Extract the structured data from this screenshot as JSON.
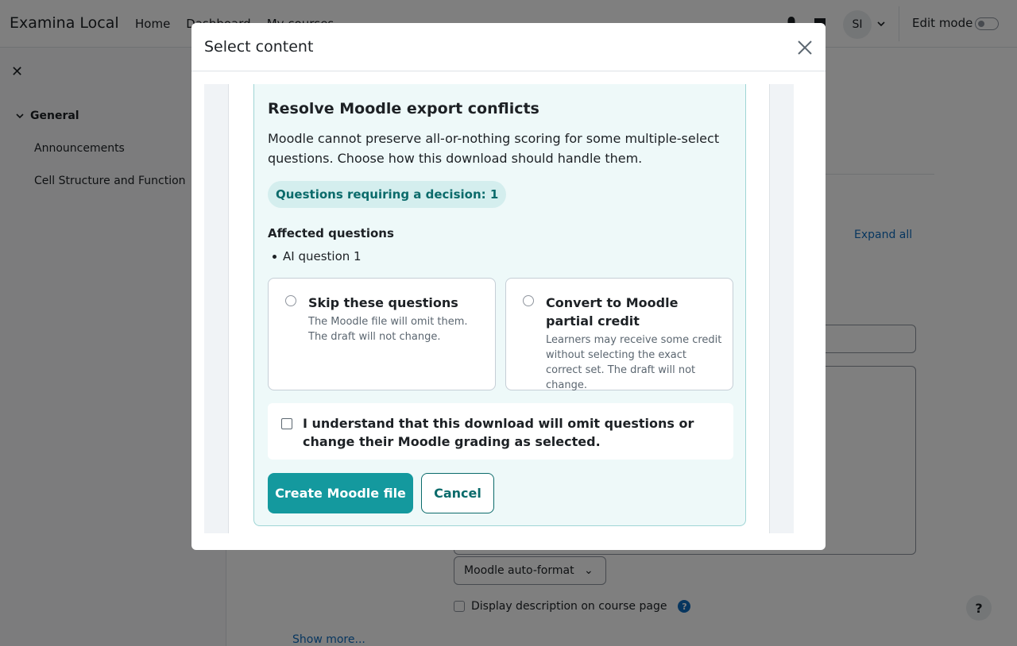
{
  "navbar": {
    "brand": "Examina Local",
    "links": [
      "Home",
      "Dashboard",
      "My courses"
    ],
    "avatar_initials": "SI",
    "edit_mode_label": "Edit mode"
  },
  "drawer": {
    "section": "General",
    "items": [
      "Announcements",
      "Cell Structure and Function"
    ]
  },
  "main": {
    "expand_all": "Expand all",
    "format_select": "Moodle auto-format",
    "display_description": "Display description on course page",
    "help_symbol": "?",
    "show_more": "Show more..."
  },
  "help_button": "?",
  "modal": {
    "title": "Select content",
    "panel": {
      "title": "Resolve Moodle export conflicts",
      "description": "Moodle cannot preserve all-or-nothing scoring for some multiple-select questions. Choose how this download should handle them.",
      "pill": "Questions requiring a decision: 1",
      "affected_title": "Affected questions",
      "affected_items": [
        "AI question 1"
      ],
      "options": [
        {
          "title": "Skip these questions",
          "description": "The Moodle file will omit them. The draft will not change."
        },
        {
          "title": "Convert to Moodle partial credit",
          "description": "Learners may receive some credit without selecting the exact correct set. The draft will not change."
        }
      ],
      "acknowledge": "I understand that this download will omit questions or change their Moodle grading as selected.",
      "primary_button": "Create Moodle file",
      "cancel_button": "Cancel"
    }
  },
  "colors": {
    "accent": "#14999e",
    "accent_dark": "#0b6b6b",
    "panel_bg": "#eef9f9",
    "link": "#0f6cbf"
  }
}
